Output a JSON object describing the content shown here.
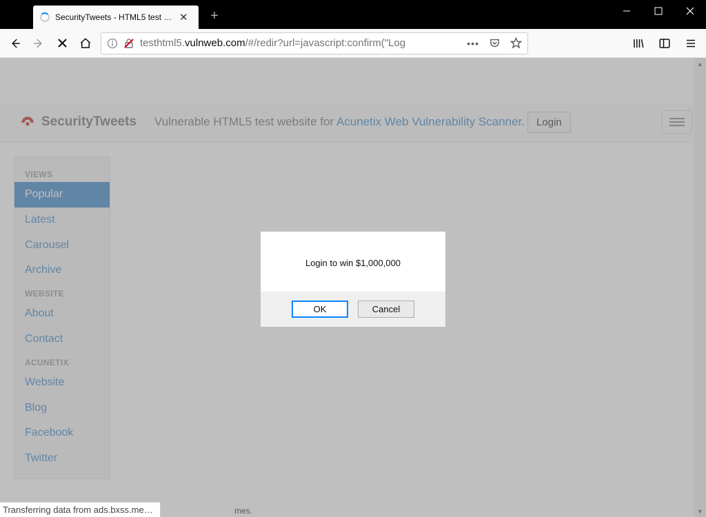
{
  "window": {
    "tab_title": "SecurityTweets - HTML5 test we"
  },
  "toolbar": {
    "url_display_prefix": "testhtml5.",
    "url_display_host": "vulnweb.com",
    "url_display_path": "/#/redir?url=javascript:confirm(\"Log"
  },
  "site": {
    "brand": "SecurityTweets",
    "tagline_pre": "Vulnerable HTML5 test website for ",
    "tagline_link": "Acunetix Web Vulnerability Scanner",
    "tagline_post": ".",
    "login_label": "Login"
  },
  "sidebar": {
    "groups": [
      {
        "title": "VIEWS",
        "items": [
          "Popular",
          "Latest",
          "Carousel",
          "Archive"
        ]
      },
      {
        "title": "WEBSITE",
        "items": [
          "About",
          "Contact"
        ]
      },
      {
        "title": "ACUNETIX",
        "items": [
          "Website",
          "Blog",
          "Facebook",
          "Twitter"
        ]
      }
    ]
  },
  "dialog": {
    "message": "Login to win $1,000,000",
    "ok": "OK",
    "cancel": "Cancel"
  },
  "status": "Transferring data from ads.bxss.me…",
  "footer_fragment": "mes."
}
